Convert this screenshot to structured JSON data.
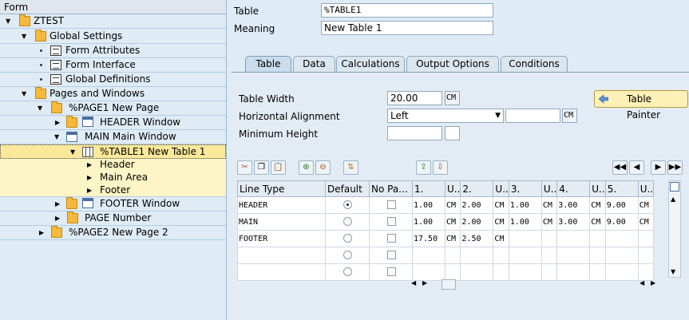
{
  "tree": {
    "header": "Form",
    "nodes": [
      {
        "label": "ZTEST"
      },
      {
        "label": "Global Settings"
      },
      {
        "label": "Form Attributes"
      },
      {
        "label": "Form Interface"
      },
      {
        "label": "Global Definitions"
      },
      {
        "label": "Pages and Windows"
      },
      {
        "label": "%PAGE1 New Page"
      },
      {
        "label": "HEADER Window"
      },
      {
        "label": "MAIN Main Window"
      },
      {
        "label": "%TABLE1 New Table 1"
      },
      {
        "label": "Header"
      },
      {
        "label": "Main Area"
      },
      {
        "label": "Footer"
      },
      {
        "label": "FOOTER Window"
      },
      {
        "label": "PAGE Number"
      },
      {
        "label": "%PAGE2 New Page 2"
      }
    ]
  },
  "form": {
    "table_label": "Table",
    "table_value": "%TABLE1",
    "meaning_label": "Meaning",
    "meaning_value": "New Table 1"
  },
  "tabs": [
    "Table",
    "Data",
    "Calculations",
    "Output Options",
    "Conditions"
  ],
  "table_tab": {
    "width_label": "Table Width",
    "width_value": "20.00",
    "width_unit": "CM",
    "halign_label": "Horizontal Alignment",
    "halign_value": "Left",
    "halign_unit": "CM",
    "minh_label": "Minimum Height",
    "painter_label": "Table Painter"
  },
  "grid": {
    "headers": [
      "Line Type",
      "Default",
      "No Pa...",
      "1.",
      "U..",
      "2.",
      "U..",
      "3.",
      "U..",
      "4.",
      "U..",
      "5.",
      "U.."
    ],
    "rows": [
      {
        "type": "HEADER",
        "default": true,
        "cells": [
          "1.00",
          "CM",
          "2.00",
          "CM",
          "1.00",
          "CM",
          "3.00",
          "CM",
          "9.00",
          "CM"
        ]
      },
      {
        "type": "MAIN",
        "default": false,
        "cells": [
          "1.00",
          "CM",
          "2.00",
          "CM",
          "1.00",
          "CM",
          "3.00",
          "CM",
          "9.00",
          "CM"
        ]
      },
      {
        "type": "FOOTER",
        "default": false,
        "cells": [
          "17.50",
          "CM",
          "2.50",
          "CM",
          "",
          "",
          "",
          "",
          "",
          ""
        ]
      },
      {
        "type": "",
        "default": false,
        "cells": [
          "",
          "",
          "",
          "",
          "",
          "",
          "",
          "",
          "",
          ""
        ]
      },
      {
        "type": "",
        "default": false,
        "cells": [
          "",
          "",
          "",
          "",
          "",
          "",
          "",
          "",
          "",
          ""
        ]
      }
    ]
  }
}
